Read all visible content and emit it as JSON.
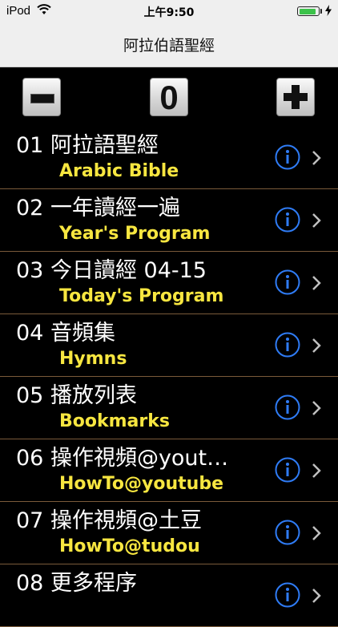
{
  "status_bar": {
    "carrier": "iPod",
    "time": "上午9:50",
    "battery_level": 0.9,
    "battery_color": "#3cc24a"
  },
  "nav": {
    "title": "阿拉伯語聖經"
  },
  "toolbar": {
    "counter": "0",
    "minus_icon": "minus-icon",
    "plus_icon": "plus-icon"
  },
  "colors": {
    "background": "#000000",
    "title_text": "#ffffff",
    "subtitle_text": "#f7e640",
    "info_icon": "#2f7cf6",
    "separator": "#7a5a3a"
  },
  "items": [
    {
      "title": "01 阿拉語聖經",
      "subtitle": "Arabic Bible"
    },
    {
      "title": "02 一年讀經一遍",
      "subtitle": "Year's Program"
    },
    {
      "title": "03 今日讀經 04-15",
      "subtitle": "Today's Program"
    },
    {
      "title": "04 音頻集",
      "subtitle": "Hymns"
    },
    {
      "title": "05 播放列表",
      "subtitle": "Bookmarks"
    },
    {
      "title": "06 操作視頻@yout…",
      "subtitle": "HowTo@youtube"
    },
    {
      "title": "07 操作視頻@土豆",
      "subtitle": "HowTo@tudou"
    },
    {
      "title": "08 更多程序",
      "subtitle": ""
    }
  ]
}
